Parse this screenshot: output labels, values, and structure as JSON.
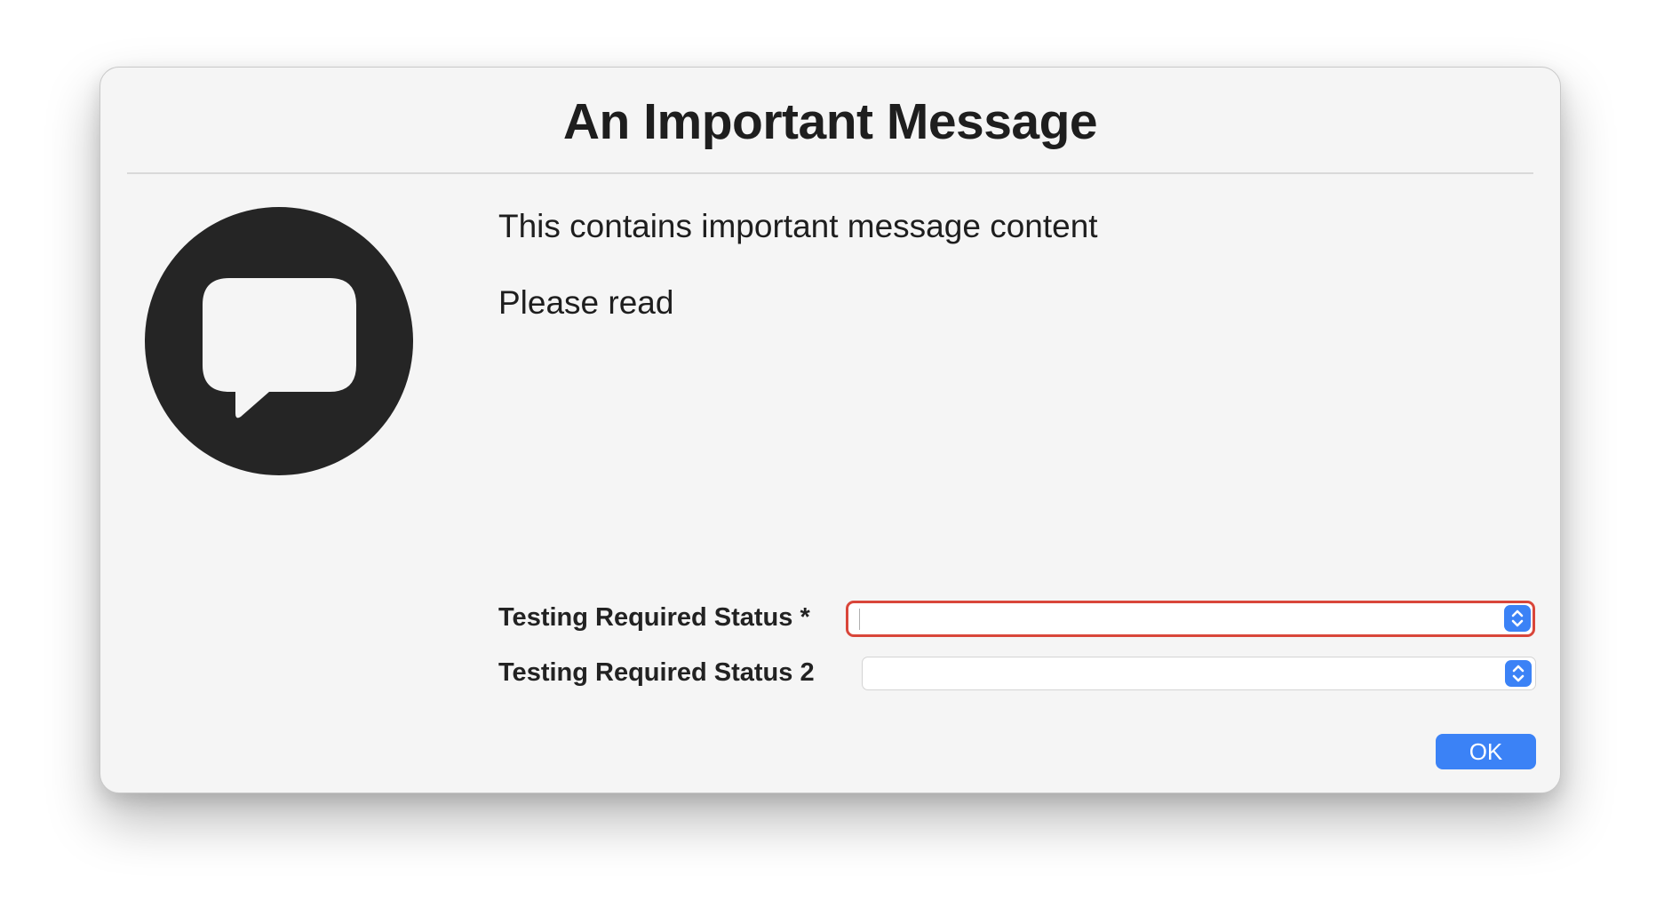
{
  "dialog": {
    "title": "An Important Message",
    "avatar_icon": "speech-bubble-icon",
    "message_lines": [
      "This contains important message content",
      "Please read"
    ],
    "fields": [
      {
        "label": "Testing Required Status *",
        "value": "",
        "state": "error"
      },
      {
        "label": "Testing Required Status 2",
        "value": ""
      }
    ],
    "ok_label": "OK"
  },
  "colors": {
    "accent": "#3b82f6",
    "error": "#d9463a",
    "icon": "#252525",
    "background": "#f5f5f5"
  }
}
